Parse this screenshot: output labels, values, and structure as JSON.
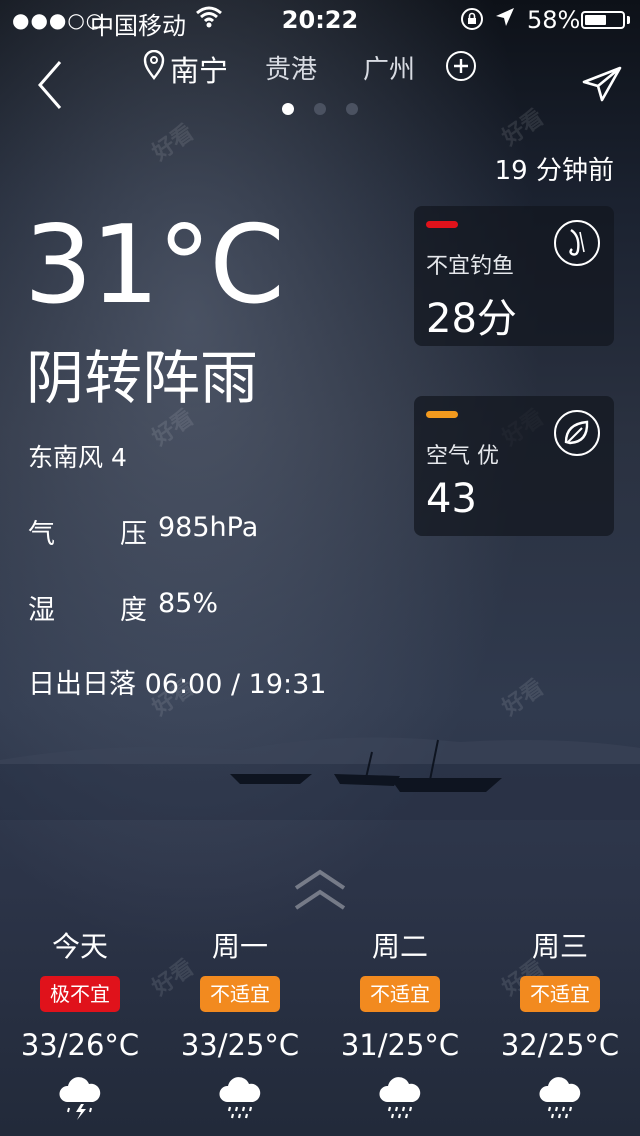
{
  "status_bar": {
    "signal": "●●●○○",
    "carrier": "中国移动",
    "time": "20:22",
    "battery_percent": "58%",
    "battery_level": 0.58
  },
  "nav": {
    "cities": [
      "南宁",
      "贵港",
      "广州"
    ],
    "active_city_index": 0,
    "page_count": 3
  },
  "updated": "19 分钟前",
  "current": {
    "temperature": "31°C",
    "condition": "阴转阵雨",
    "wind": "东南风 4",
    "pressure_label": "气",
    "pressure_label_2": "压",
    "pressure_value": "985hPa",
    "humidity_label": "湿",
    "humidity_label_2": "度",
    "humidity_value": "85%",
    "sunrise_sunset": "日出日落 06:00 / 19:31"
  },
  "cards": {
    "fishing": {
      "title": "不宜钓鱼",
      "value": "28分",
      "color": "#e0121b"
    },
    "air": {
      "title": "空气 优",
      "value": "43",
      "color": "#f39a1e"
    }
  },
  "forecast": [
    {
      "day": "今天",
      "badge": "极不宜",
      "badge_color": "#e0121b",
      "range": "33/26°C",
      "icon": "thunder-rain-icon"
    },
    {
      "day": "周一",
      "badge": "不适宜",
      "badge_color": "#f28a1f",
      "range": "33/25°C",
      "icon": "rain-icon"
    },
    {
      "day": "周二",
      "badge": "不适宜",
      "badge_color": "#f28a1f",
      "range": "31/25°C",
      "icon": "rain-icon"
    },
    {
      "day": "周三",
      "badge": "不适宜",
      "badge_color": "#f28a1f",
      "range": "32/25°C",
      "icon": "rain-icon"
    }
  ]
}
